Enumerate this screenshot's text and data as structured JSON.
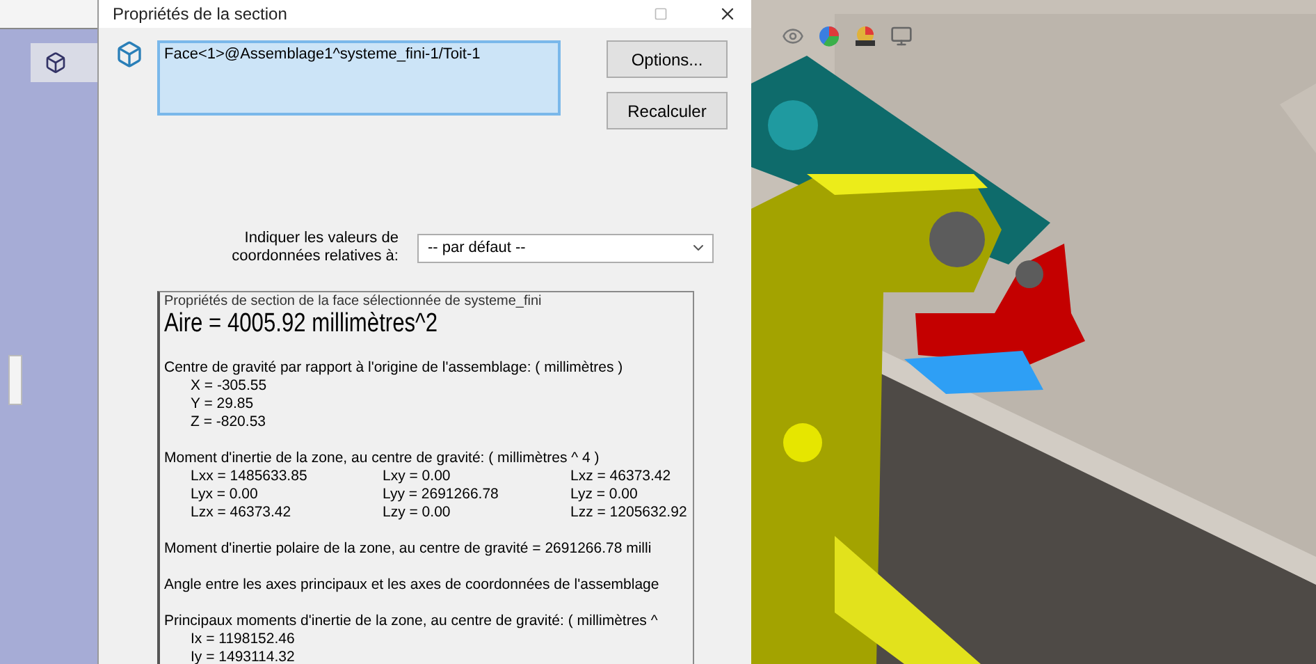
{
  "dialog": {
    "title": "Propriétés de la section",
    "selection": "Face<1>@Assemblage1^systeme_fini-1/Toit-1",
    "buttons": [
      "Options...",
      "Recalculer"
    ],
    "coord_label": [
      "Indiquer les valeurs de",
      "coordonnées relatives à:"
    ],
    "coord_select": "-- par défaut --",
    "results": [
      {
        "kind": "caption",
        "text": "Propriétés de section de la face sélectionnée de systeme_fini"
      },
      {
        "kind": "area",
        "text": "Aire = 4005.92 millimètres^2"
      },
      {
        "kind": "section",
        "title": "Centre de gravité par rapport à l'origine de l'assemblage: ( millimètres )",
        "lines": [
          "X = -305.55",
          "Y = 29.85",
          "Z = -820.53"
        ]
      },
      {
        "kind": "matrix",
        "title": "Moment d'inertie de la zone, au centre de gravité: ( millimètres ^ 4 )",
        "rows": [
          [
            "Lxx = 1485633.85",
            "Lxy = 0.00",
            "Lxz = 46373.42"
          ],
          [
            "Lyx = 0.00",
            "Lyy = 2691266.78",
            "Lyz = 0.00"
          ],
          [
            "Lzx = 46373.42",
            "Lzy = 0.00",
            "Lzz = 1205632.92"
          ]
        ]
      },
      {
        "kind": "section",
        "title": "Moment d'inertie polaire de la zone, au centre de gravité = 2691266.78 milli"
      },
      {
        "kind": "section",
        "title": "Angle entre les axes principaux et les axes de coordonnées de l'assemblage"
      },
      {
        "kind": "section",
        "title": "Principaux moments d'inertie de la zone, au centre de gravité: ( millimètres ^",
        "lines": [
          "Ix = 1198152.46",
          "Iy = 1493114.32"
        ]
      }
    ]
  }
}
